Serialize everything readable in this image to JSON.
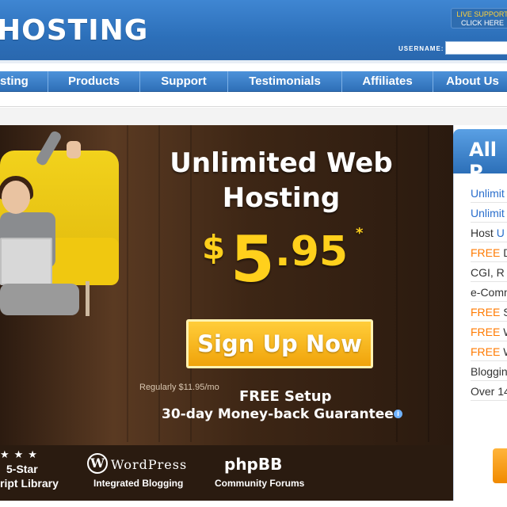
{
  "header": {
    "logo": "HOSTING",
    "live_support": [
      "LIVE SUPPORT",
      "CLICK HERE"
    ],
    "username_label": "USERNAME:"
  },
  "nav": {
    "items": [
      "sting",
      "Products",
      "Support",
      "Testimonials",
      "Affiliates",
      "About Us"
    ]
  },
  "hero": {
    "headline_1": "Unlimited Web",
    "headline_2": "Hosting",
    "price_currency": "$",
    "price_whole": "5",
    "price_decimal": ".95",
    "price_star": "*",
    "signup_label": "Sign Up Now",
    "regularly": "Regularly $11.95/mo",
    "free_setup": "FREE Setup",
    "guarantee": "30-day Money-back Guarantee",
    "info_icon": "i"
  },
  "features": {
    "stars": "★★★",
    "five_star": "5-Star",
    "library": "ript Library",
    "wordpress_mark": "W",
    "wordpress": "WordPress",
    "wordpress_sub": "Integrated Blogging",
    "phpbb": "phpBB",
    "phpbb_sub": "Community Forums"
  },
  "side": {
    "title": "All P",
    "items": [
      {
        "text": "Unlimit"
      },
      {
        "text": "Unlimit"
      },
      {
        "pre": "Host ",
        "blue": "U"
      },
      {
        "free": "FREE",
        "rest": " D"
      },
      {
        "text": "CGI, R"
      },
      {
        "text": "e-Comm"
      },
      {
        "free": "FREE",
        "rest": " S"
      },
      {
        "free": "FREE",
        "rest": " W"
      },
      {
        "free": "FREE",
        "rest": " W"
      },
      {
        "text": "Bloggin"
      },
      {
        "text": "Over 14"
      }
    ]
  },
  "colors": {
    "header_blue": "#2c6fb9",
    "price_yellow": "#ffd01c",
    "button_orange": "#f0a30a",
    "link_blue": "#2a6ecc",
    "free_orange": "#ff7a00"
  }
}
